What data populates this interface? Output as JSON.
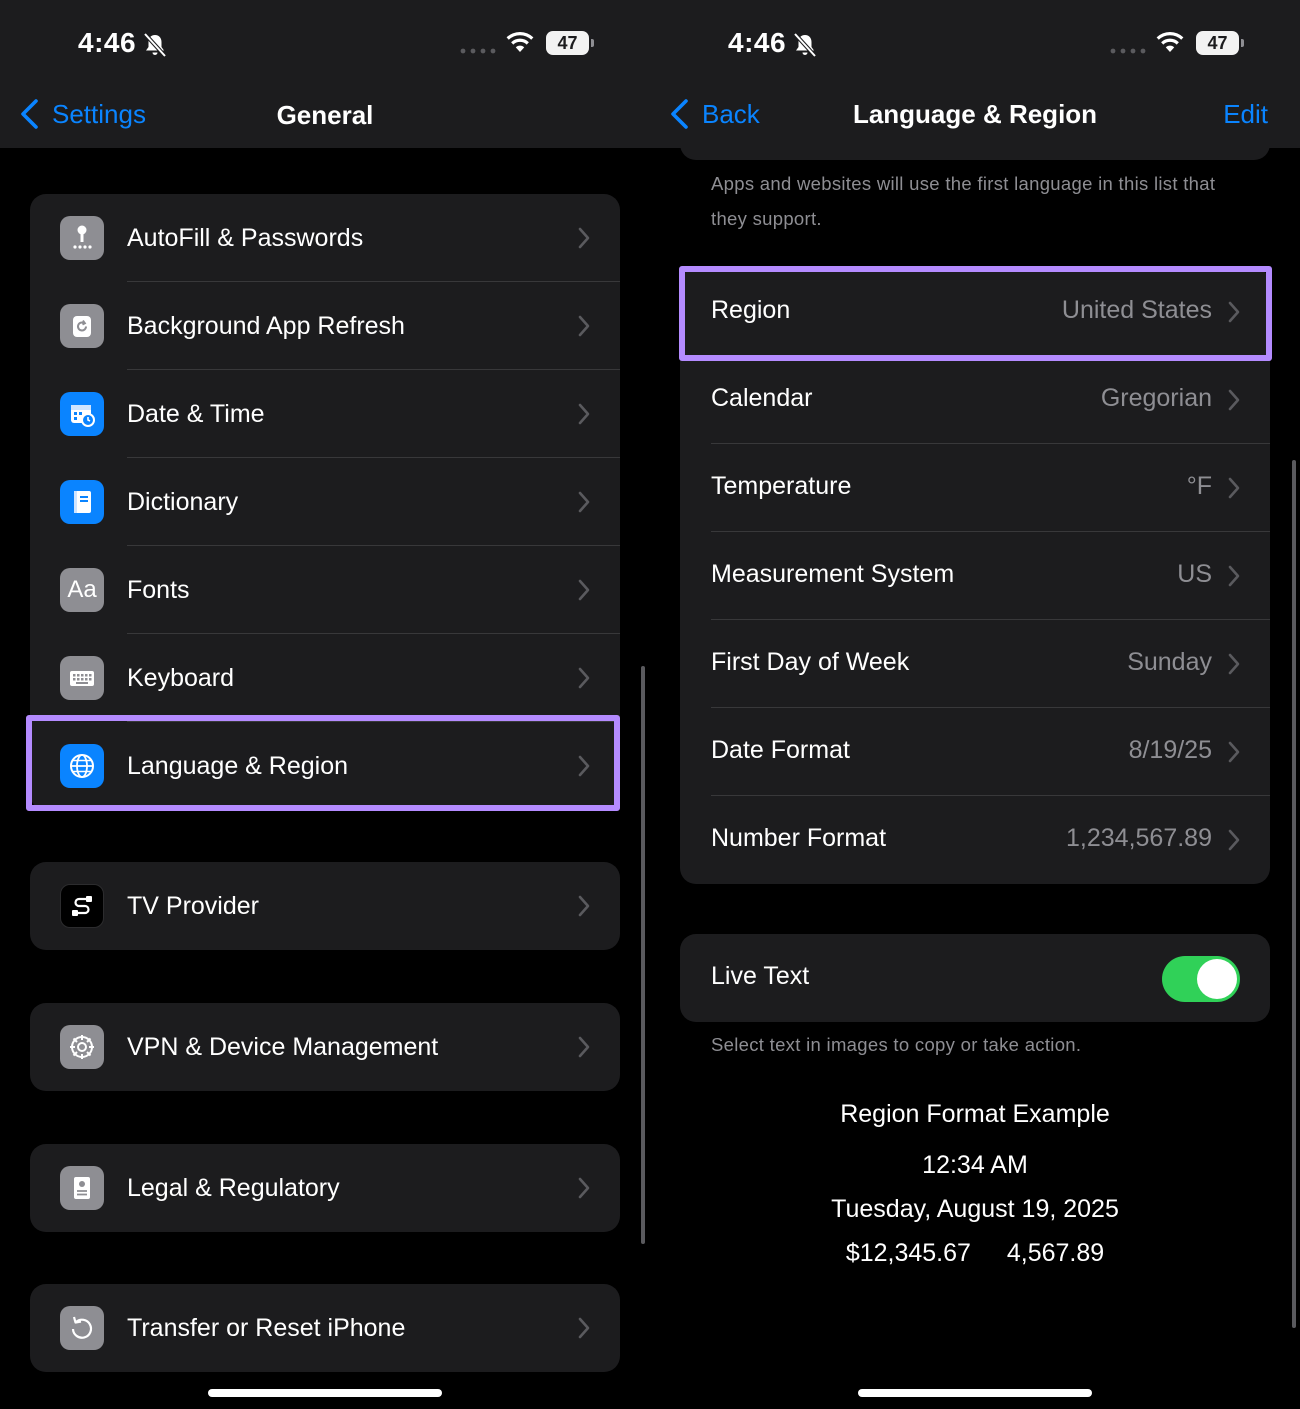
{
  "left": {
    "status": {
      "time": "4:46",
      "battery": "47"
    },
    "nav": {
      "back_label": "Settings",
      "title": "General"
    },
    "groups": [
      [
        {
          "label": "AutoFill & Passwords",
          "icon": "key-icon",
          "color": "#8e8e93"
        },
        {
          "label": "Background App Refresh",
          "icon": "refresh-icon",
          "color": "#8e8e93"
        },
        {
          "label": "Date & Time",
          "icon": "calendar-clock-icon",
          "color": "#0a84ff"
        },
        {
          "label": "Dictionary",
          "icon": "book-icon",
          "color": "#0a84ff"
        },
        {
          "label": "Fonts",
          "icon": "fonts-icon",
          "icon_text": "Aa",
          "color": "#8e8e93"
        },
        {
          "label": "Keyboard",
          "icon": "keyboard-icon",
          "color": "#8e8e93"
        },
        {
          "label": "Language & Region",
          "icon": "globe-icon",
          "color": "#0a84ff",
          "highlighted": true
        }
      ],
      [
        {
          "label": "TV Provider",
          "icon": "tv-provider-icon",
          "color": "#000000"
        }
      ],
      [
        {
          "label": "VPN & Device Management",
          "icon": "gear-icon",
          "color": "#8e8e93"
        }
      ],
      [
        {
          "label": "Legal & Regulatory",
          "icon": "document-icon",
          "color": "#8e8e93"
        }
      ],
      [
        {
          "label": "Transfer or Reset iPhone",
          "icon": "reset-icon",
          "color": "#8e8e93"
        }
      ]
    ]
  },
  "right": {
    "status": {
      "time": "4:46",
      "battery": "47"
    },
    "nav": {
      "back_label": "Back",
      "title": "Language & Region",
      "edit_label": "Edit"
    },
    "language_note": "Apps and websites will use the first language in this list that they support.",
    "settings": [
      {
        "label": "Region",
        "value": "United States",
        "highlighted": true
      },
      {
        "label": "Calendar",
        "value": "Gregorian"
      },
      {
        "label": "Temperature",
        "value": "°F"
      },
      {
        "label": "Measurement System",
        "value": "US"
      },
      {
        "label": "First Day of Week",
        "value": "Sunday"
      },
      {
        "label": "Date Format",
        "value": "8/19/25"
      },
      {
        "label": "Number Format",
        "value": "1,234,567.89"
      }
    ],
    "live_text": {
      "label": "Live Text",
      "enabled": true,
      "note": "Select text in images to copy or take action."
    },
    "example": {
      "title": "Region Format Example",
      "time": "12:34 AM",
      "date": "Tuesday, August 19, 2025",
      "currency": "$12,345.67",
      "number": "4,567.89"
    },
    "accent_color": "#0a84ff",
    "highlight_color": "#b48bff",
    "toggle_color": "#30d158"
  }
}
